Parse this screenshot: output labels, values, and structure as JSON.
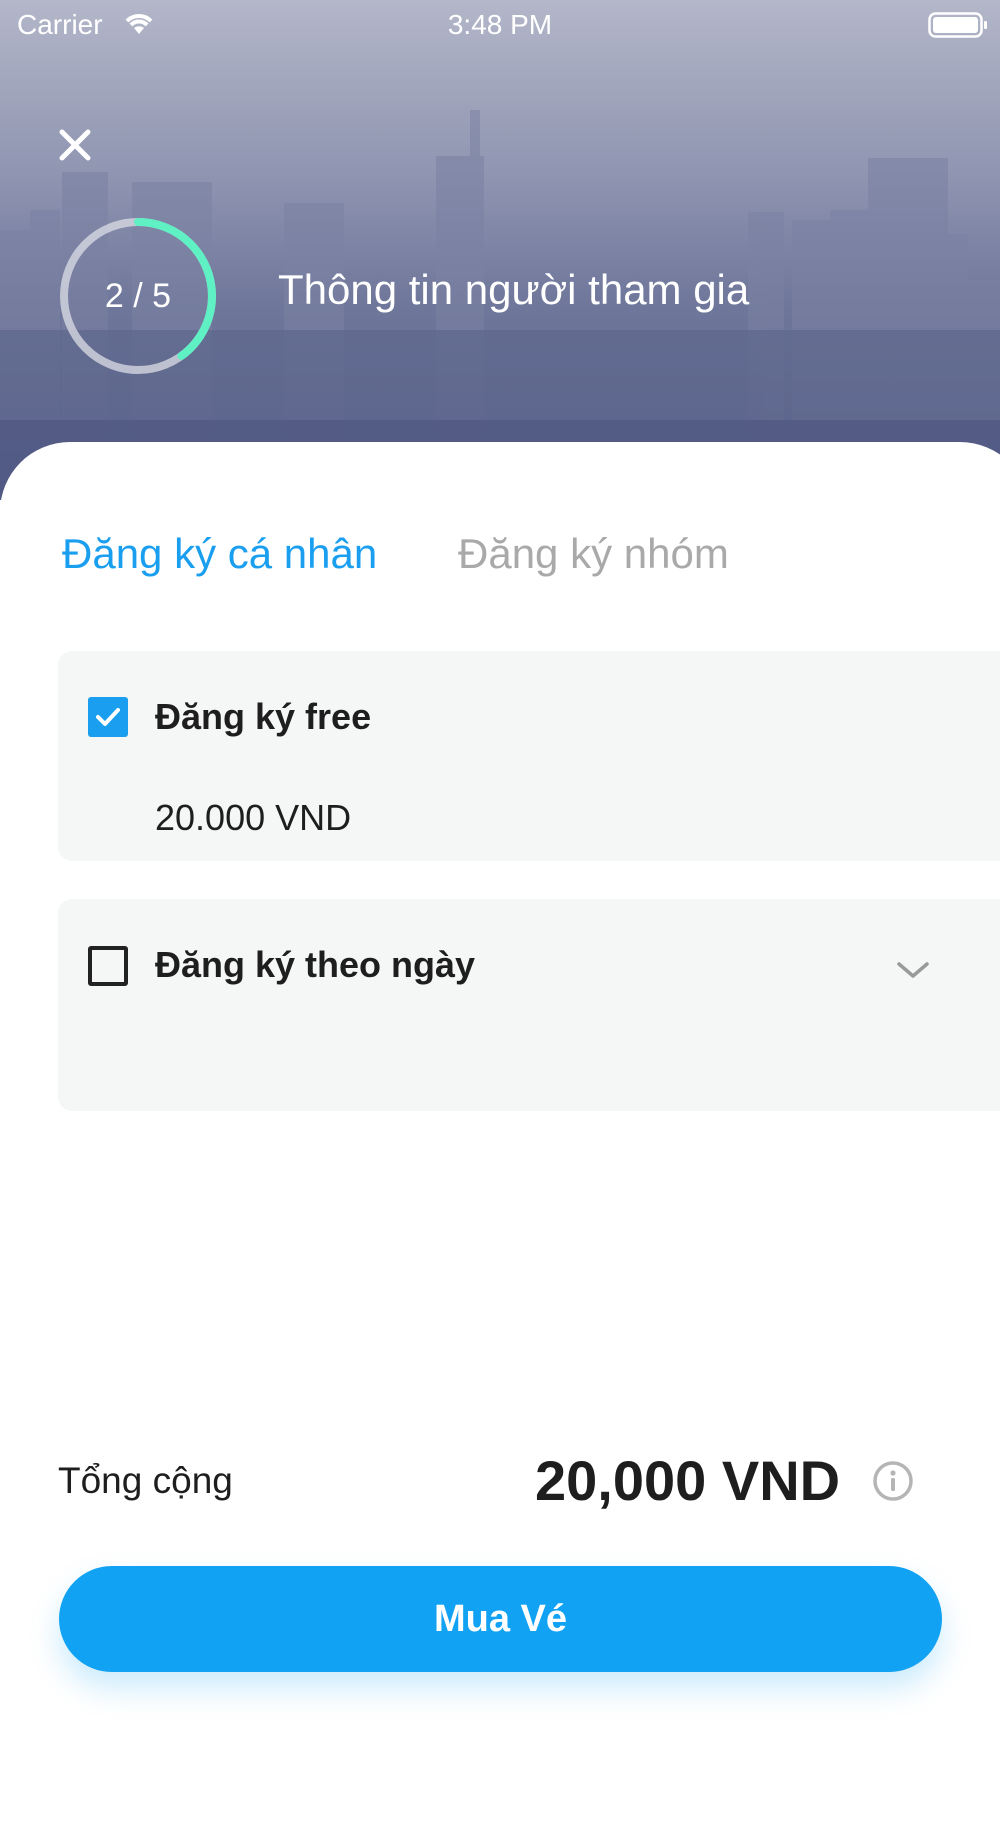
{
  "status_bar": {
    "carrier": "Carrier",
    "time": "3:48 PM",
    "wifi_icon": "wifi-icon",
    "battery_icon": "battery-icon"
  },
  "header": {
    "close_icon": "close-icon",
    "progress": {
      "current": 2,
      "total": 5,
      "label": "2 / 5",
      "fraction": 0.4
    },
    "title": "Thông tin người tham gia"
  },
  "tabs": [
    {
      "label": "Đăng ký cá nhân",
      "active": true
    },
    {
      "label": "Đăng ký nhóm",
      "active": false
    }
  ],
  "options": [
    {
      "title": "Đăng ký free",
      "price": "20.000 VND",
      "checked": true
    },
    {
      "title": "Đăng ký theo ngày",
      "checked": false,
      "expand_icon": "chevron-down-icon"
    }
  ],
  "summary": {
    "total_label": "Tổng cộng",
    "total_value": "20,000 VND",
    "info_icon": "info-icon"
  },
  "actions": {
    "buy_label": "Mua Vé"
  },
  "colors": {
    "accent": "#12a2f3",
    "progress_accent": "#5ff0c4",
    "inactive_tab": "#a9a9a9",
    "card_background": "#f5f7f6"
  }
}
